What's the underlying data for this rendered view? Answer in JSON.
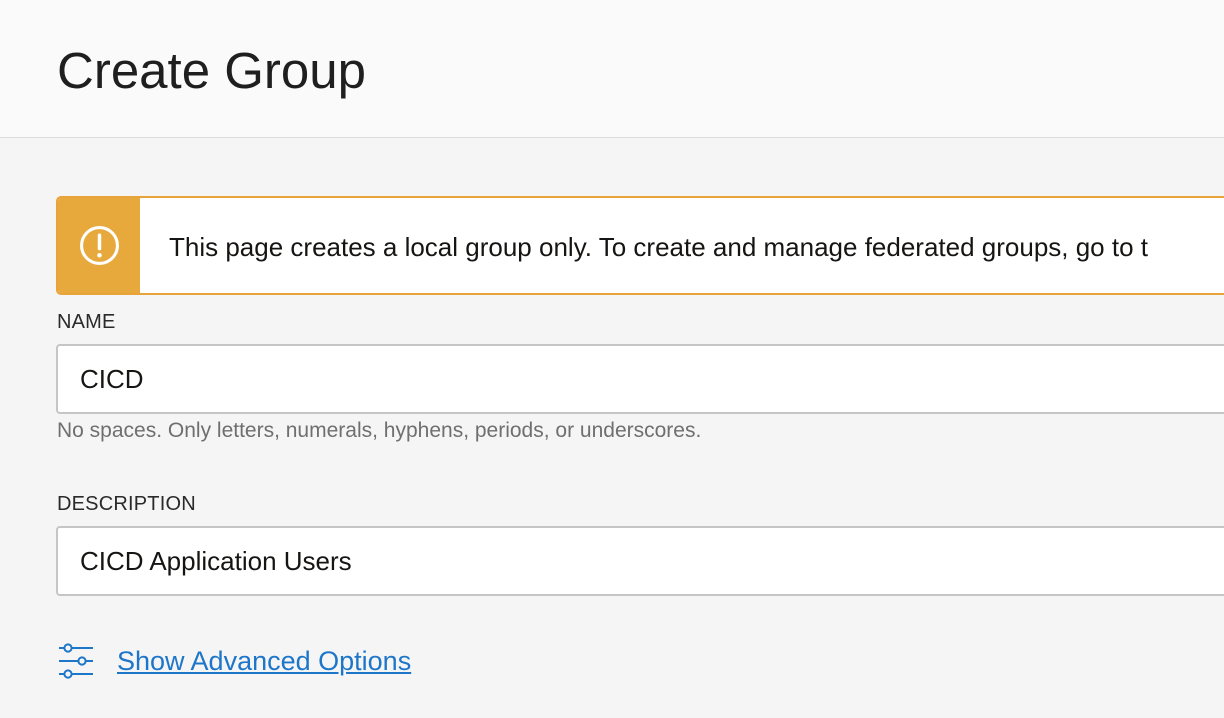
{
  "page": {
    "title": "Create Group"
  },
  "alert": {
    "icon": "warning-exclamation-icon",
    "message": "This page creates a local group only. To create and manage federated groups, go to t",
    "accent_color": "#e8a93c"
  },
  "form": {
    "name": {
      "label": "NAME",
      "value": "CICD",
      "help": "No spaces. Only letters, numerals, hyphens, periods, or underscores."
    },
    "description": {
      "label": "DESCRIPTION",
      "value": "CICD Application Users"
    },
    "advanced": {
      "icon": "sliders-icon",
      "label": "Show Advanced Options",
      "link_color": "#1e76c9"
    }
  }
}
